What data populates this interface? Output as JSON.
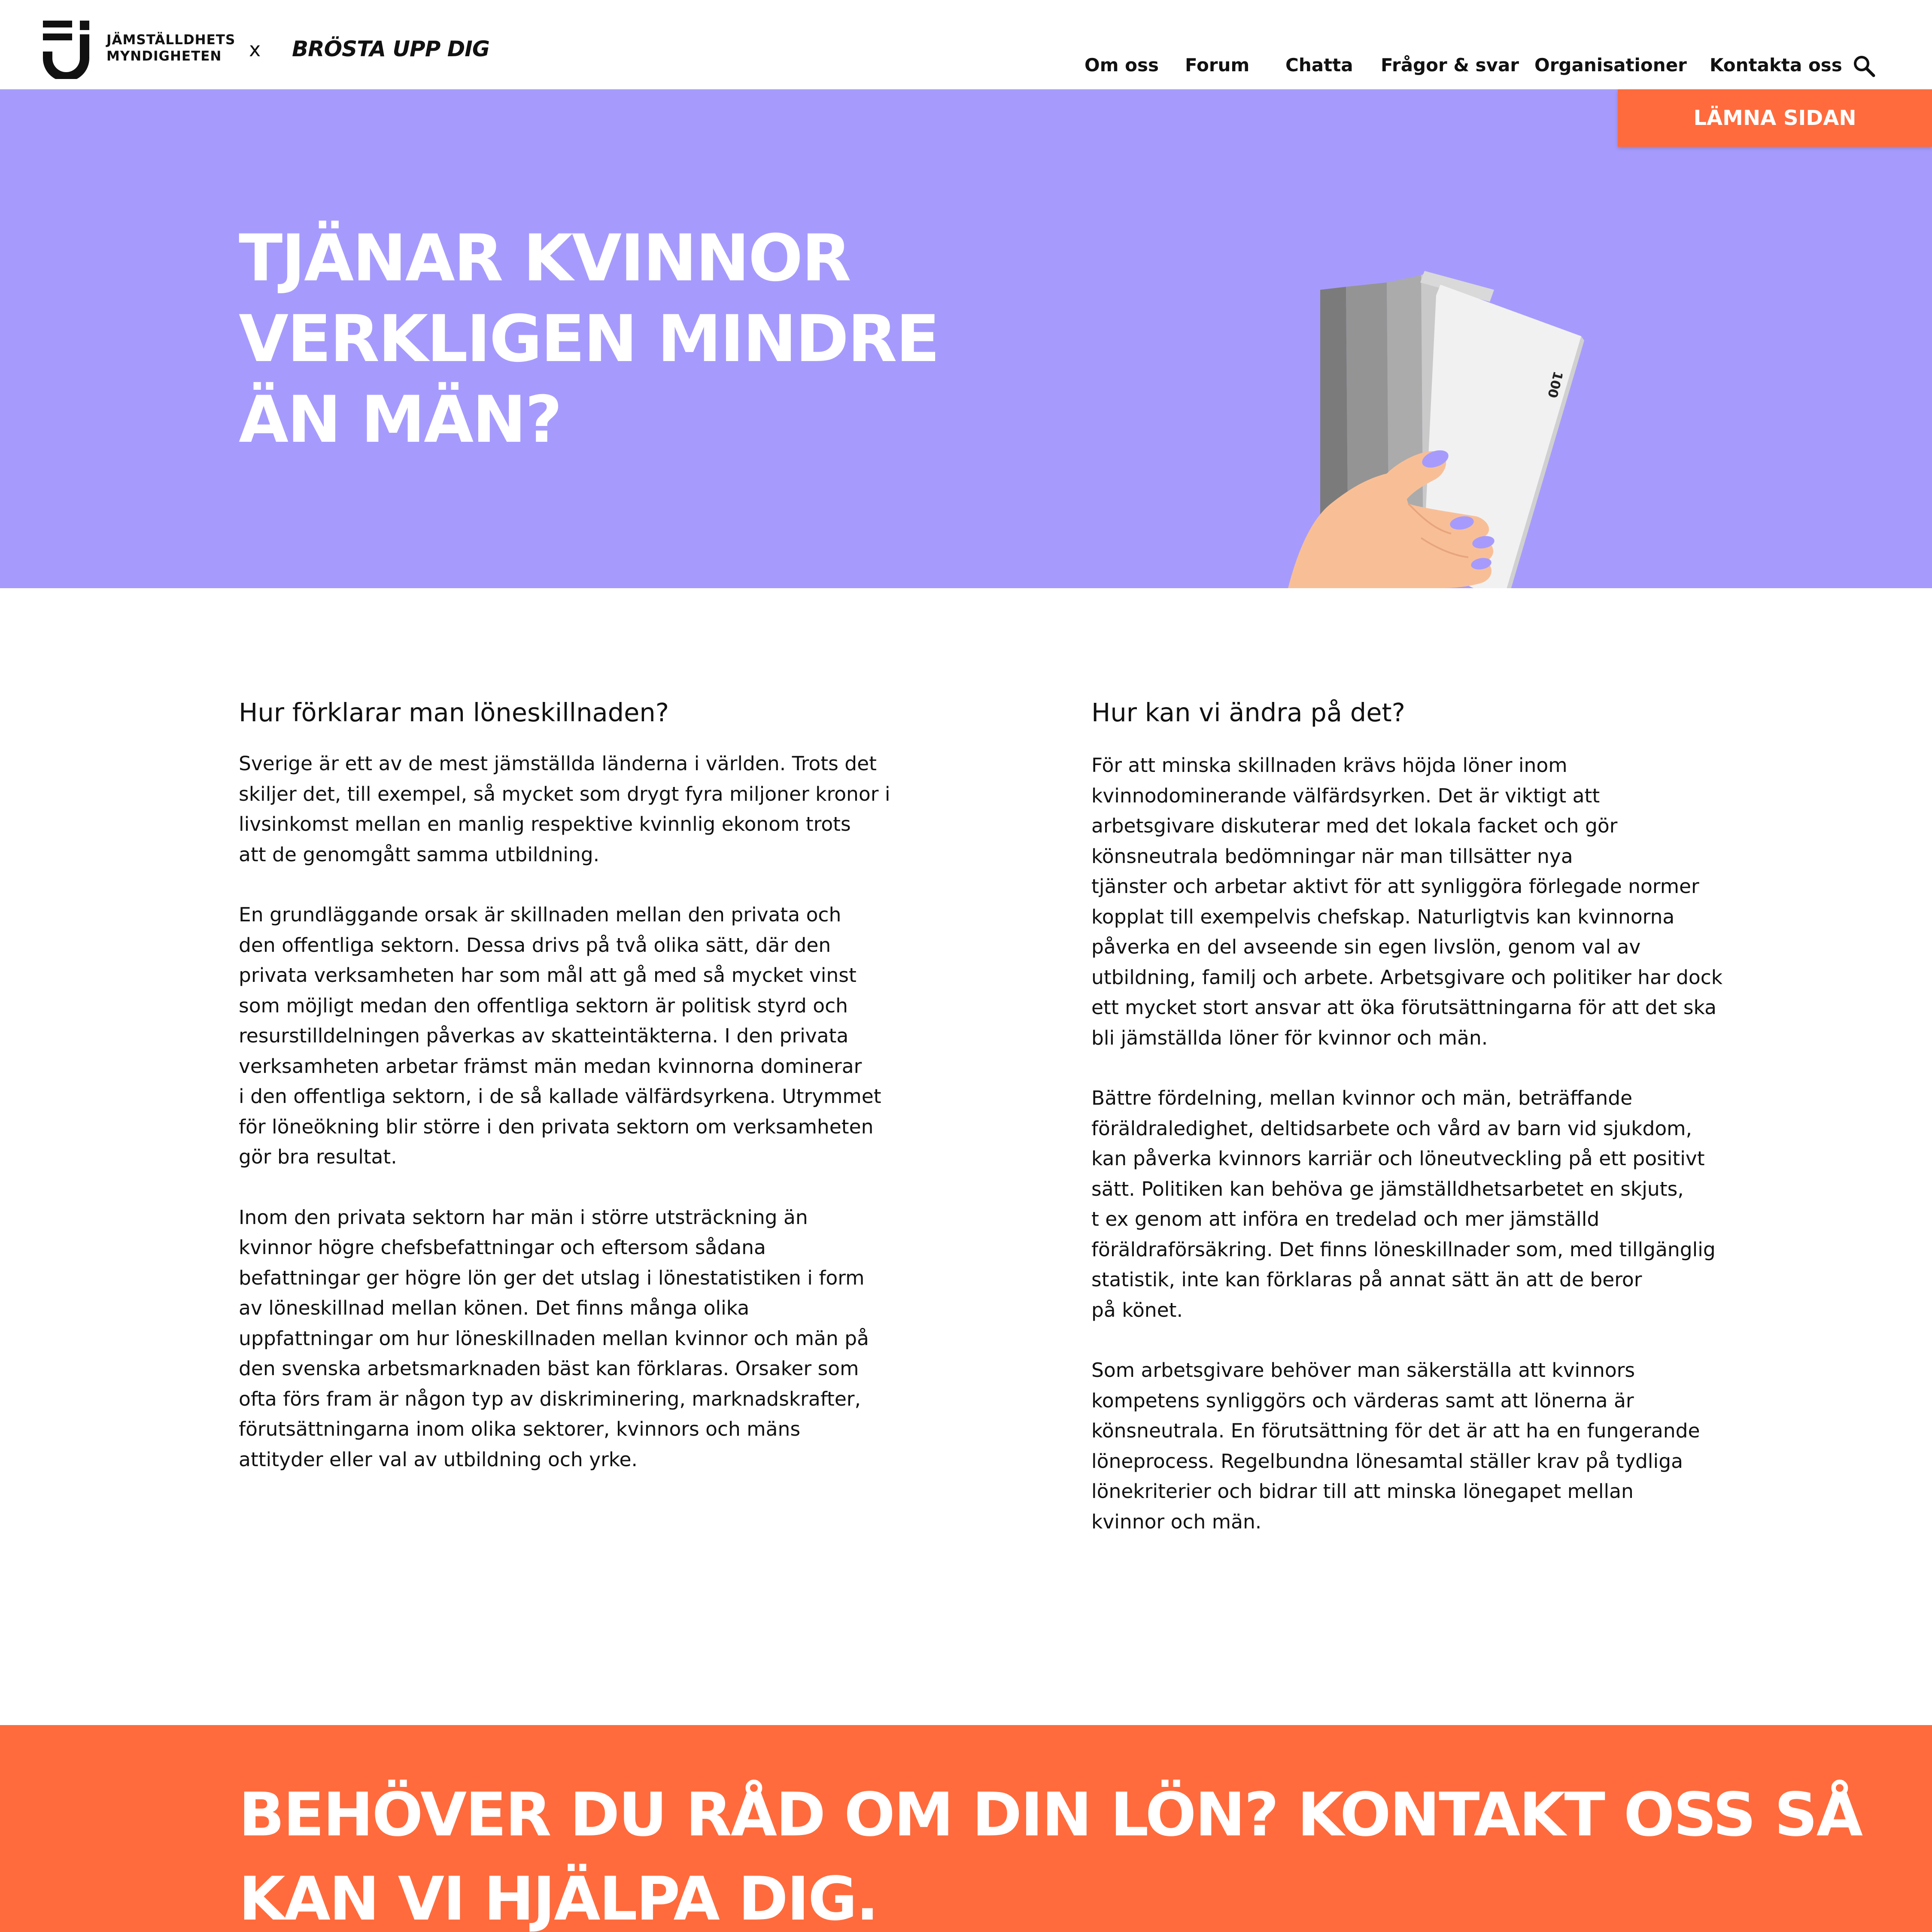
{
  "header": {
    "logo_line1": "JÄMSTÄLLDHETS",
    "logo_line2": "MYNDIGHETEN",
    "separator": "x",
    "partner": "BRÖSTA UPP DIG",
    "nav": [
      "Om oss",
      "Forum",
      "Chatta",
      "Frågor & svar",
      "Organisationer",
      "Kontakta oss"
    ],
    "search_icon": "search-icon"
  },
  "hero": {
    "background": "#a69bfc",
    "leave_button": "LÄMNA SIDAN",
    "title_lines": [
      "TJÄNAR KVINNOR",
      "VERKLIGEN MINDRE",
      "ÄN MÄN?"
    ],
    "banknote_label": "100"
  },
  "left": {
    "heading": "Hur förklarar man löneskillnaden?",
    "paragraphs": [
      [
        "Sverige är ett av de mest jämställda länderna i världen. Trots det",
        "skiljer det, till exempel, så mycket som drygt fyra miljoner kronor i",
        "livsinkomst  mellan en manlig respektive kvinnlig ekonom trots",
        "att de genomgått samma utbildning."
      ],
      [
        "En grundläggande orsak är skillnaden mellan den privata och",
        "den offentliga sektorn. Dessa drivs på två olika sätt, där den",
        "privata verksamheten har som mål att gå med så mycket vinst",
        "som möjligt medan den offentliga sektorn är politisk styrd och",
        "resurstilldelningen påverkas av skatteintäkterna. I den privata",
        "verksamheten arbetar främst män medan kvinnorna dominerar",
        "i den offentliga sektorn, i de så kallade välfärdsyrkena. Utrymmet",
        "för löneökning blir större i den privata sektorn om verksamheten",
        "gör bra resultat."
      ],
      [
        "Inom den privata sektorn har män i större utsträckning än",
        "kvinnor högre chefsbefattningar och eftersom sådana",
        "befattningar ger högre lön ger det utslag i lönestatistiken i form",
        "av löneskillnad mellan könen. Det finns många olika",
        "uppfattningar om hur löneskillnaden mellan kvinnor och män på",
        "den svenska arbetsmarknaden bäst kan förklaras. Orsaker som",
        "ofta förs fram är någon typ av diskriminering, marknadskrafter,",
        "förutsättningarna inom olika sektorer, kvinnors och mäns",
        "attityder eller val av utbildning och yrke."
      ]
    ]
  },
  "right": {
    "heading": "Hur kan vi ändra på det?",
    "paragraphs": [
      [
        "För att minska skillnaden krävs höjda löner inom",
        "kvinnodominerande välfärdsyrken. Det är viktigt att",
        "arbetsgivare diskuterar med det lokala facket och gör",
        "könsneutrala bedömningar när man tillsätter nya",
        "tjänster och arbetar aktivt för att synliggöra förlegade normer",
        "kopplat till exempelvis chefskap. Naturligtvis kan kvinnorna",
        "påverka en del avseende sin egen livslön, genom val av",
        "utbildning, familj och arbete. Arbetsgivare och politiker har dock",
        "ett mycket stort ansvar att öka förutsättningarna för att det ska",
        "bli jämställda löner för kvinnor och män."
      ],
      [
        "Bättre fördelning, mellan kvinnor och män, beträffande",
        "föräldraledighet, deltidsarbete och vård av barn vid sjukdom,",
        "kan påverka kvinnors karriär och löneutveckling på ett positivt",
        "sätt. Politiken kan behöva ge jämställdhetsarbetet en skjuts,",
        "t ex genom att införa en tredelad och mer jämställd",
        "föräldraförsäkring. Det finns löneskillnader som, med tillgänglig",
        "statistik, inte kan förklaras på annat sätt än att de beror",
        "på könet."
      ],
      [
        "Som arbetsgivare behöver man säkerställa att kvinnors",
        "kompetens synliggörs och värderas samt att lönerna är",
        "könsneutrala. En förutsättning för det är att ha en fungerande",
        "löneprocess. Regelbundna lönesamtal ställer krav på tydliga",
        "lönekriterier och bidrar till att minska lönegapet mellan",
        "kvinnor och män."
      ]
    ]
  },
  "cta": {
    "background": "#ff6b3d",
    "lines": [
      "BEHÖVER DU RÅD OM DIN LÖN?  KONTAKT OSS SÅ",
      "KAN VI HJÄLPA DIG."
    ]
  }
}
